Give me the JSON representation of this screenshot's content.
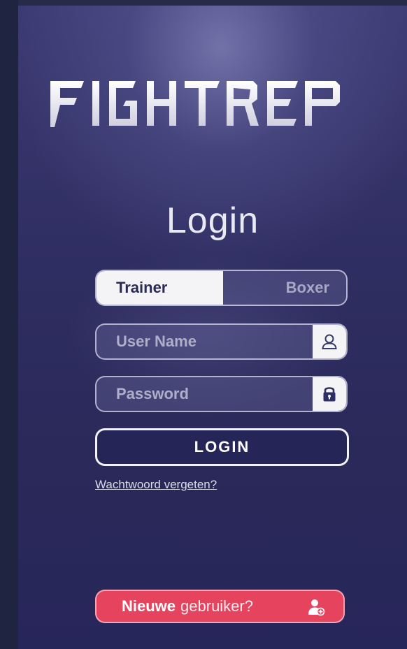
{
  "app": {
    "logo_text": "FIGHTREP"
  },
  "login": {
    "title": "Login",
    "role_toggle": {
      "options": [
        "Trainer",
        "Boxer"
      ],
      "selected": "Trainer"
    },
    "username": {
      "placeholder": "User Name",
      "value": "",
      "icon": "user-icon"
    },
    "password": {
      "placeholder": "Password",
      "value": "",
      "icon": "lock-icon"
    },
    "submit_label": "LOGIN",
    "forgot_label": "Wachtwoord vergeten?"
  },
  "register": {
    "label_bold": "Nieuwe",
    "label_rest": "gebruiker?",
    "icon": "add-user-icon"
  },
  "colors": {
    "background": "#2f2e62",
    "accent_pink": "#e6435f",
    "button_dark": "#262557",
    "light": "#f4f4f6"
  }
}
